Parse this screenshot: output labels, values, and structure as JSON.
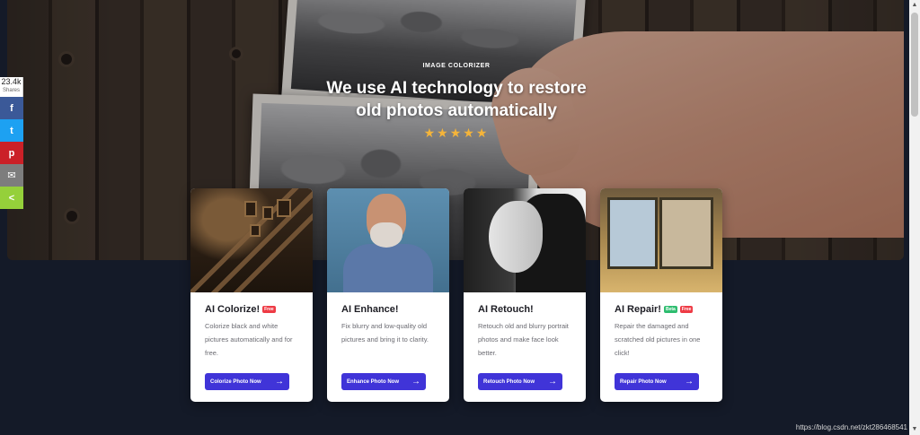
{
  "hero": {
    "eyebrow": "IMAGE COLORIZER",
    "headline_line1": "We use AI technology to restore",
    "headline_line2": "old photos automatically",
    "stars": "★★★★★"
  },
  "share": {
    "count": "23.4k",
    "label": "Shares",
    "facebook_icon": "f",
    "twitter_icon": "t",
    "pinterest_icon": "p",
    "email_icon": "✉",
    "share_icon": "<"
  },
  "cards": [
    {
      "title": "AI Colorize!",
      "badges": [
        "Free"
      ],
      "desc": "Colorize black and white pictures automatically and for free.",
      "cta": "Colorize Photo Now"
    },
    {
      "title": "AI Enhance!",
      "badges": [],
      "desc": "Fix blurry and low-quality old pictures and bring it to clarity.",
      "cta": "Enhance Photo Now"
    },
    {
      "title": "AI Retouch!",
      "badges": [],
      "desc": "Retouch old and blurry portrait photos and make face look better.",
      "cta": "Retouch Photo Now"
    },
    {
      "title": "AI Repair!",
      "badges": [
        "Beta",
        "Free"
      ],
      "desc": "Repair the damaged and scratched old pictures in one click!",
      "cta": "Repair Photo Now"
    }
  ],
  "cta_arrow": "→",
  "watermark": "https://blog.csdn.net/zkt286468541",
  "scrollbar": {
    "up": "▲",
    "down": "▼"
  },
  "colors": {
    "accent": "#4034d8",
    "free_badge": "#ee3b45",
    "beta_badge": "#2ebd6f",
    "stars": "#f4b43a"
  }
}
